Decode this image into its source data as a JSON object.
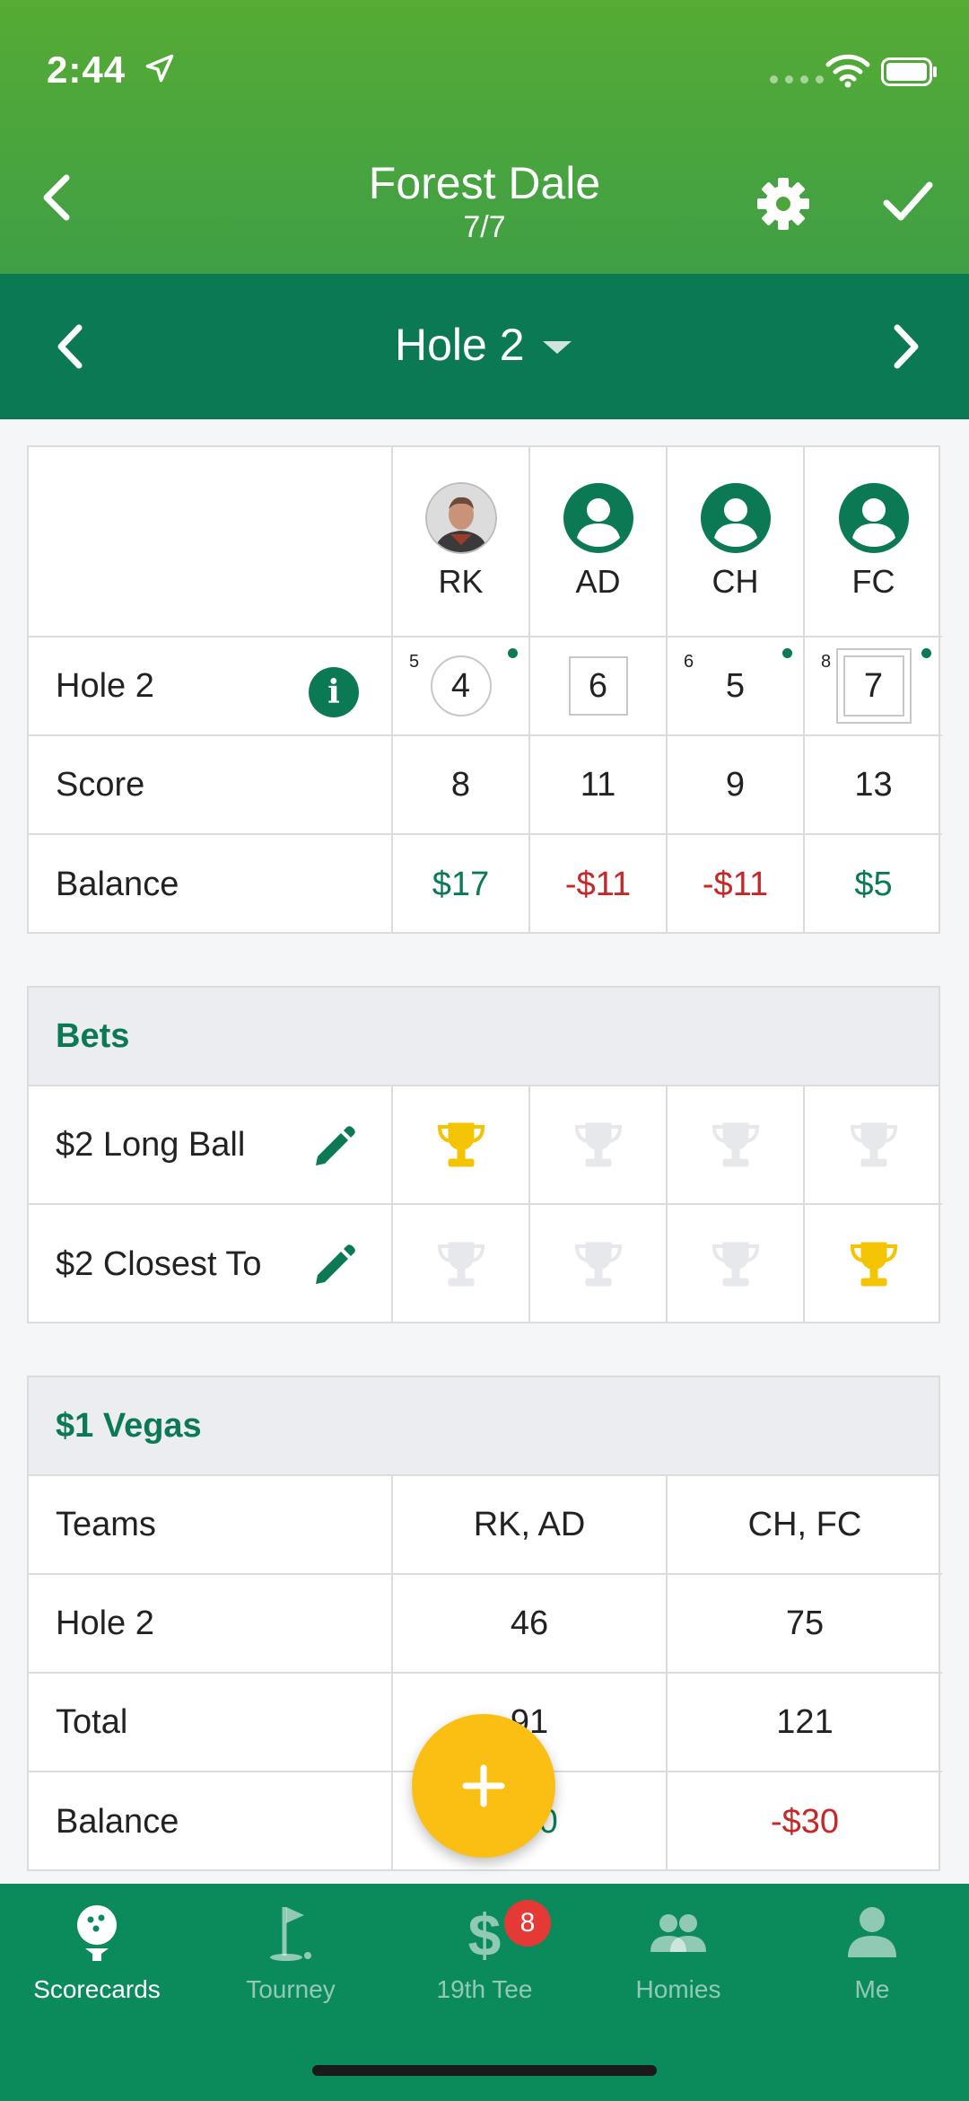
{
  "status": {
    "time": "2:44"
  },
  "header": {
    "title": "Forest Dale",
    "subtitle": "7/7"
  },
  "hole_nav": {
    "title": "Hole 2"
  },
  "players": [
    {
      "initials": "RK",
      "par_mark": "5",
      "score": "4",
      "total": "8",
      "balance": "$17",
      "balance_color": "#0b7a54"
    },
    {
      "initials": "AD",
      "par_mark": "",
      "score": "6",
      "total": "11",
      "balance": "-$11",
      "balance_color": "#c62828"
    },
    {
      "initials": "CH",
      "par_mark": "6",
      "score": "5",
      "total": "9",
      "balance": "-$11",
      "balance_color": "#c62828"
    },
    {
      "initials": "FC",
      "par_mark": "8",
      "score": "7",
      "total": "13",
      "balance": "$5",
      "balance_color": "#0b7a54"
    }
  ],
  "rows": {
    "hole_label": "Hole 2",
    "score_label": "Score",
    "balance_label": "Balance"
  },
  "bets": {
    "title": "Bets",
    "items": [
      {
        "label": "$2 Long Ball",
        "winner_index": 0
      },
      {
        "label": "$2 Closest To",
        "winner_index": 3
      }
    ]
  },
  "vegas": {
    "title": "$1 Vegas",
    "rows": [
      {
        "label": "Teams",
        "a": "RK, AD",
        "b": "CH, FC"
      },
      {
        "label": "Hole 2",
        "a": "46",
        "b": "75"
      },
      {
        "label": "Total",
        "a": "91",
        "b": "121"
      },
      {
        "label": "Balance",
        "a": "$30",
        "b": "-$30"
      }
    ]
  },
  "nav": {
    "tabs": [
      {
        "label": "Scorecards"
      },
      {
        "label": "Tourney"
      },
      {
        "label": "19th Tee",
        "badge": "8"
      },
      {
        "label": "Homies"
      },
      {
        "label": "Me"
      }
    ]
  },
  "colors": {
    "primary_green": "#0b7a54",
    "header_green": "#4ea63a",
    "trophy_gold": "#f5c400",
    "negative_red": "#c62828",
    "fab_yellow": "#fbbf14"
  }
}
